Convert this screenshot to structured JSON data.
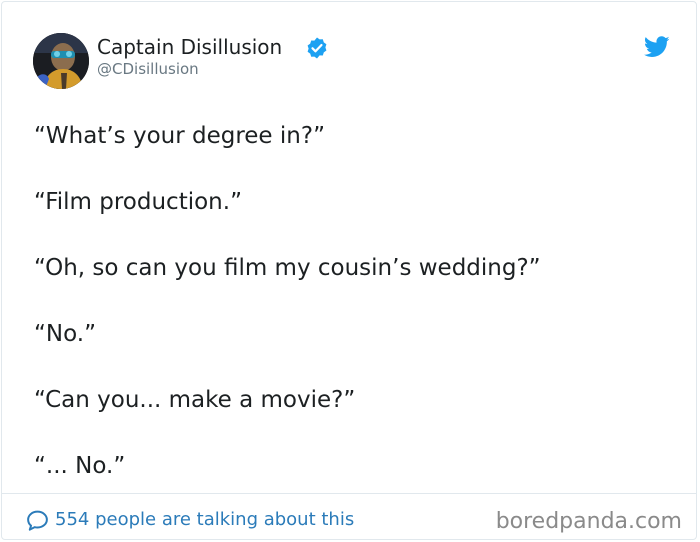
{
  "author": {
    "display_name": "Captain Disillusion",
    "handle": "@CDisillusion",
    "verified": true,
    "avatar_icon": "profile-photo"
  },
  "platform_icon": "twitter-bird-icon",
  "tweet": {
    "lines": [
      "“What’s your degree in?”",
      "“Film production.”",
      "“Oh, so can you film my cousin’s wedding?”",
      "“No.”",
      "“Can you... make a movie?”",
      "“... No.”"
    ]
  },
  "footer": {
    "conversation_text": "554 people are talking about this",
    "icon": "reply-bubble-icon"
  },
  "watermark": "boredpanda.com",
  "colors": {
    "text": "#1c2022",
    "muted": "#697882",
    "link": "#2b7bb9",
    "verified": "#1da1f2",
    "twitter_blue": "#1da1f2",
    "border": "#e1e8ed",
    "watermark": "#8a8a8a"
  }
}
